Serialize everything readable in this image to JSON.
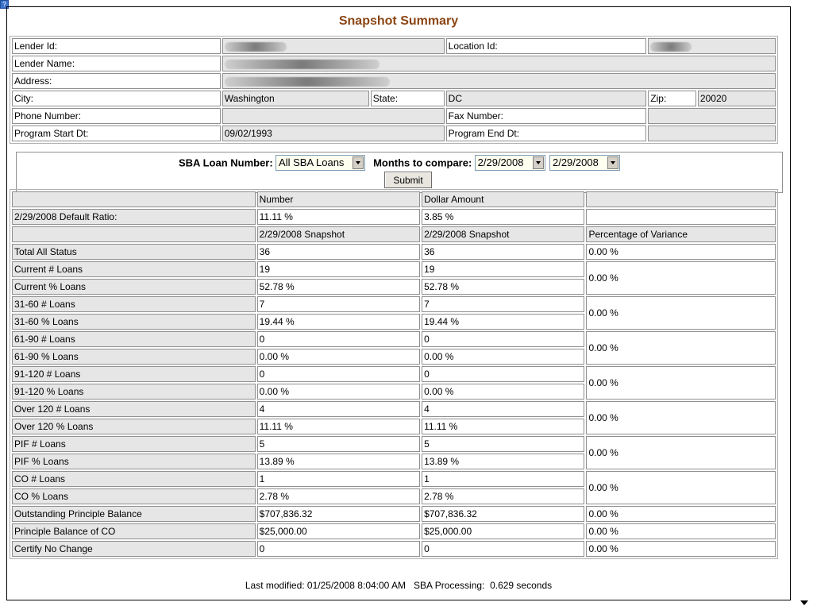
{
  "page": {
    "title": "Snapshot Summary"
  },
  "lender": {
    "lender_id_label": "Lender Id:",
    "location_id_label": "Location Id:",
    "lender_name_label": "Lender Name:",
    "address_label": "Address:",
    "city_label": "City:",
    "city": "Washington",
    "state_label": "State:",
    "state": "DC",
    "zip_label": "Zip:",
    "zip": "20020",
    "phone_label": "Phone Number:",
    "phone": "",
    "fax_label": "Fax Number:",
    "fax": "",
    "start_label": "Program Start Dt:",
    "start": "09/02/1993",
    "end_label": "Program End Dt:",
    "end": ""
  },
  "form": {
    "loan_label": "SBA Loan Number:",
    "loan_value": "All SBA Loans",
    "months_label": "Months to compare:",
    "month1": "2/29/2008",
    "month2": "2/29/2008",
    "submit_label": "Submit"
  },
  "summary": {
    "number_header": "Number",
    "dollar_header": "Dollar Amount",
    "default_label": "2/29/2008 Default Ratio:",
    "default_number": "11.11 %",
    "default_dollar": "3.85 %",
    "snap1_header": "2/29/2008 Snapshot",
    "snap2_header": "2/29/2008 Snapshot",
    "variance_header": "Percentage of Variance",
    "total_label": "Total All Status",
    "total_a": "36",
    "total_b": "36",
    "total_var": "0.00 %",
    "groups": [
      {
        "l1": "Current # Loans",
        "a1": "19",
        "b1": "19",
        "l2": "Current % Loans",
        "a2": "52.78 %",
        "b2": "52.78 %",
        "var": "0.00 %"
      },
      {
        "l1": "31-60 # Loans",
        "a1": "7",
        "b1": "7",
        "l2": "31-60 % Loans",
        "a2": "19.44 %",
        "b2": "19.44 %",
        "var": "0.00 %"
      },
      {
        "l1": "61-90 # Loans",
        "a1": "0",
        "b1": "0",
        "l2": "61-90 % Loans",
        "a2": "0.00 %",
        "b2": "0.00 %",
        "var": "0.00 %"
      },
      {
        "l1": "91-120 # Loans",
        "a1": "0",
        "b1": "0",
        "l2": "91-120 % Loans",
        "a2": "0.00 %",
        "b2": "0.00 %",
        "var": "0.00 %"
      },
      {
        "l1": "Over 120 # Loans",
        "a1": "4",
        "b1": "4",
        "l2": "Over 120 % Loans",
        "a2": "11.11 %",
        "b2": "11.11 %",
        "var": "0.00 %"
      },
      {
        "l1": "PIF # Loans",
        "a1": "5",
        "b1": "5",
        "l2": "PIF % Loans",
        "a2": "13.89 %",
        "b2": "13.89 %",
        "var": "0.00 %"
      },
      {
        "l1": "CO # Loans",
        "a1": "1",
        "b1": "1",
        "l2": "CO % Loans",
        "a2": "2.78 %",
        "b2": "2.78 %",
        "var": "0.00 %"
      }
    ],
    "singles": [
      {
        "label": "Outstanding Principle Balance",
        "a": "$707,836.32",
        "b": "$707,836.32",
        "var": "0.00 %"
      },
      {
        "label": "Principle Balance of CO",
        "a": "$25,000.00",
        "b": "$25,000.00",
        "var": "0.00 %"
      },
      {
        "label": "Certify No Change",
        "a": "0",
        "b": "0",
        "var": "0.00 %"
      }
    ]
  },
  "footer": {
    "text": "Last modified: 01/25/2008 8:04:00 AM   SBA Processing:  0.629 seconds"
  }
}
